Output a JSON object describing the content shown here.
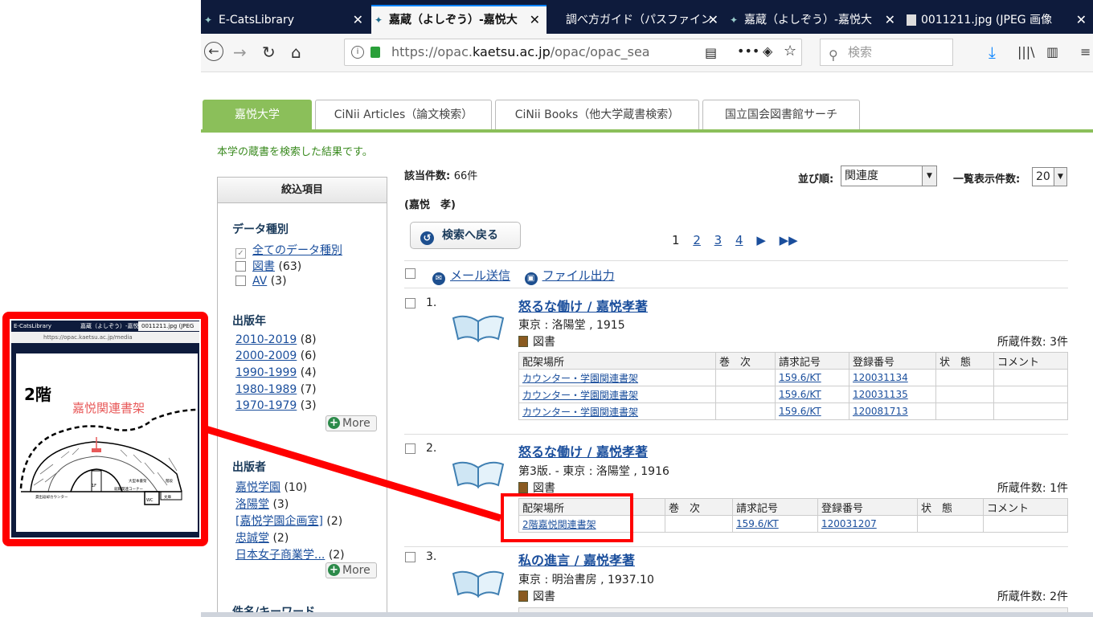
{
  "browser": {
    "tabs": [
      {
        "label": "E-CatsLibrary"
      },
      {
        "label": "嘉蔵（よしぞう）-嘉悦大"
      },
      {
        "label": "調べ方ガイド（パスファイン"
      },
      {
        "label": "嘉蔵（よしぞう）-嘉悦大"
      },
      {
        "label": "0011211.jpg (JPEG 画像"
      }
    ],
    "url_prefix": "https://opac.",
    "url_domain": "kaetsu.ac.jp",
    "url_suffix": "/opac/opac_search/",
    "search_placeholder": "検索"
  },
  "site_tabs": [
    "嘉悦大学",
    "CiNii Articles（論文検索）",
    "CiNii Books（他大学蔵書検索）",
    "国立国会図書館サーチ"
  ],
  "intro_text": "本学の蔵書を検索した結果です。",
  "facets": {
    "header": "絞込項目",
    "data_type": {
      "title": "データ種別",
      "items": [
        {
          "label": "全てのデータ種別",
          "count": ""
        },
        {
          "label": "図書",
          "count": "(63)"
        },
        {
          "label": "AV",
          "count": "(3)"
        }
      ]
    },
    "year": {
      "title": "出版年",
      "items": [
        {
          "label": "2010-2019",
          "count": "(8)"
        },
        {
          "label": "2000-2009",
          "count": "(6)"
        },
        {
          "label": "1990-1999",
          "count": "(4)"
        },
        {
          "label": "1980-1989",
          "count": "(7)"
        },
        {
          "label": "1970-1979",
          "count": "(3)"
        }
      ]
    },
    "publisher": {
      "title": "出版者",
      "items": [
        {
          "label": "嘉悦学園",
          "count": "(10)"
        },
        {
          "label": "洛陽堂",
          "count": "(3)"
        },
        {
          "label": "[嘉悦学園企画室]",
          "count": "(2)"
        },
        {
          "label": "忠誠堂",
          "count": "(2)"
        },
        {
          "label": "日本女子商業学...",
          "count": "(2)"
        }
      ]
    },
    "more_label": "More",
    "keyword_title": "件名/キーワード"
  },
  "results": {
    "count_label": "該当件数:",
    "count_value": "66件",
    "query": "(嘉悦　孝)",
    "sort_label": "並び順:",
    "sort_value": "関連度",
    "per_page_label": "一覧表示件数:",
    "per_page_value": "20",
    "back_label": "検索へ戻る",
    "pages": [
      "1",
      "2",
      "3",
      "4"
    ],
    "mail_label": "メール送信",
    "export_label": "ファイル出力",
    "holding_headers": [
      "配架場所",
      "巻　次",
      "請求記号",
      "登録番号",
      "状　態",
      "コメント"
    ],
    "items": [
      {
        "num": "1.",
        "title": "怒るな働け / 嘉悦孝著",
        "pub": "東京 : 洛陽堂 , 1915",
        "type": "図書",
        "holdings_count": "所蔵件数: 3件",
        "holdings": [
          [
            "カウンター・学園関連書架",
            "",
            "159.6/KT",
            "120031134",
            "",
            ""
          ],
          [
            "カウンター・学園関連書架",
            "",
            "159.6/KT",
            "120031135",
            "",
            ""
          ],
          [
            "カウンター・学園関連書架",
            "",
            "159.6/KT",
            "120081713",
            "",
            ""
          ]
        ]
      },
      {
        "num": "2.",
        "title": "怒るな働け / 嘉悦孝著",
        "pub": "第3版. - 東京 : 洛陽堂 , 1916",
        "type": "図書",
        "holdings_count": "所蔵件数: 1件",
        "holdings": [
          [
            "2階嘉悦関連書架",
            "",
            "159.6/KT",
            "120031207",
            "",
            ""
          ]
        ]
      },
      {
        "num": "3.",
        "title": "私の進言 / 嘉悦孝著",
        "pub": "東京 : 明治書房 , 1937.10",
        "type": "図書",
        "holdings_count": "所蔵件数: 2件"
      }
    ]
  },
  "callout": {
    "tabs": [
      "E-CatsLibrary",
      "嘉蔵（よしぞう）-嘉悦",
      "0011211.jpg (JPEG"
    ],
    "url": "https://opac.kaetsu.ac.jp/media",
    "floor_label": "2階",
    "shelf_label": "嘉悦関連書架",
    "map_labels": {
      "entrance": "1F",
      "counter": "貸出返却カウンター",
      "wc": "WC",
      "stair": "階段",
      "books_large": "大型本書架",
      "corner": "就職関連コーナー",
      "bunko": "文庫"
    }
  },
  "colors": {
    "accent_green": "#8bbf5a",
    "link": "#1a4e9c",
    "callout_red": "#ff0000",
    "tabbar": "#0e1b3c"
  }
}
